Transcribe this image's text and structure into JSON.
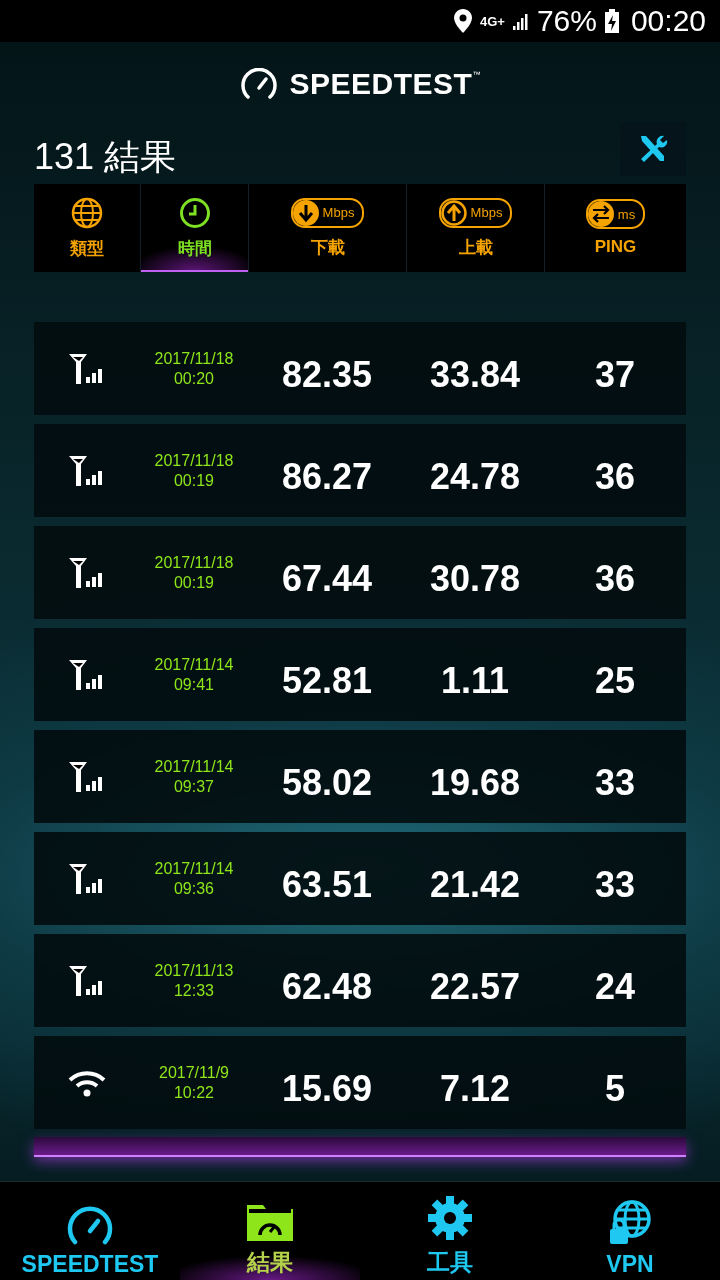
{
  "status_bar": {
    "network": "4G+",
    "battery": "76%",
    "time": "00:20"
  },
  "header": {
    "logo": "SPEEDTEST",
    "trademark": "™"
  },
  "title": "131 結果",
  "columns": [
    {
      "kind": "type",
      "label": "類型",
      "selected": false
    },
    {
      "kind": "time",
      "label": "時間",
      "selected": true
    },
    {
      "kind": "download",
      "label": "下載",
      "unit": "Mbps",
      "selected": false
    },
    {
      "kind": "upload",
      "label": "上載",
      "unit": "Mbps",
      "selected": false
    },
    {
      "kind": "ping",
      "label": "PING",
      "unit": "ms",
      "selected": false
    }
  ],
  "rows": [
    {
      "kind": "cellular",
      "date": "2017/11/18",
      "time": "00:20",
      "download": "82.35",
      "upload": "33.84",
      "ping": "37"
    },
    {
      "kind": "cellular",
      "date": "2017/11/18",
      "time": "00:19",
      "download": "86.27",
      "upload": "24.78",
      "ping": "36"
    },
    {
      "kind": "cellular",
      "date": "2017/11/18",
      "time": "00:19",
      "download": "67.44",
      "upload": "30.78",
      "ping": "36"
    },
    {
      "kind": "cellular",
      "date": "2017/11/14",
      "time": "09:41",
      "download": "52.81",
      "upload": "1.11",
      "ping": "25"
    },
    {
      "kind": "cellular",
      "date": "2017/11/14",
      "time": "09:37",
      "download": "58.02",
      "upload": "19.68",
      "ping": "33"
    },
    {
      "kind": "cellular",
      "date": "2017/11/14",
      "time": "09:36",
      "download": "63.51",
      "upload": "21.42",
      "ping": "33"
    },
    {
      "kind": "cellular",
      "date": "2017/11/13",
      "time": "12:33",
      "download": "62.48",
      "upload": "22.57",
      "ping": "24"
    },
    {
      "kind": "wifi",
      "date": "2017/11/9",
      "time": "10:22",
      "download": "15.69",
      "upload": "7.12",
      "ping": "5"
    }
  ],
  "nav": [
    {
      "kind": "speedtest",
      "label": "SPEEDTEST",
      "selected": false
    },
    {
      "kind": "results",
      "label": "結果",
      "selected": true
    },
    {
      "kind": "tools",
      "label": "工具",
      "selected": false
    },
    {
      "kind": "vpn",
      "label": "VPN",
      "selected": false
    }
  ]
}
